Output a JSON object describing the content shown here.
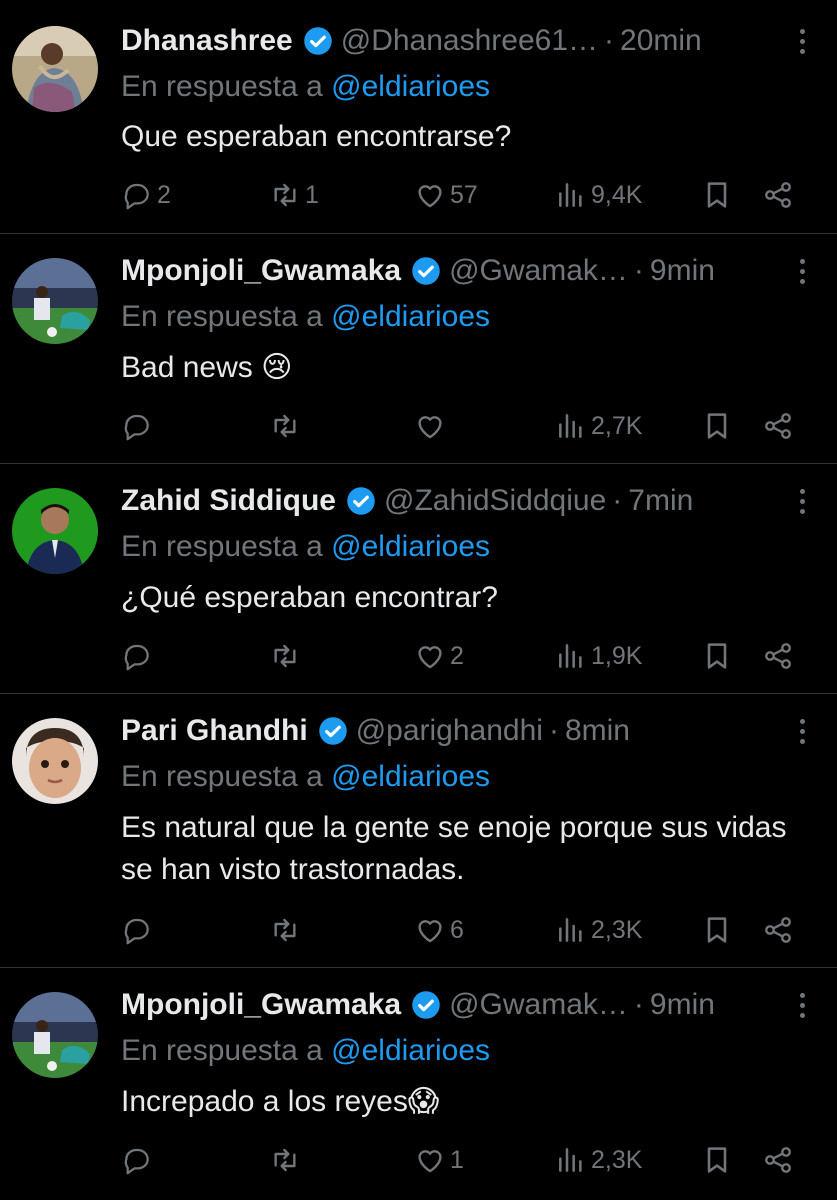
{
  "colors": {
    "background": "#000000",
    "text": "#e7e9ea",
    "muted": "#71767b",
    "link": "#1d9bf0",
    "verified": "#1d9bf0",
    "divider": "#2f3336"
  },
  "reply_prefix": "En respuesta a",
  "tweets": [
    {
      "name": "Dhanashree",
      "handle": "@Dhanashree61…",
      "time": "20min",
      "reply_to": "@eldiarioes",
      "text": "Que esperaban encontrarse?",
      "replies": "2",
      "retweets": "1",
      "likes": "57",
      "views": "9,4K",
      "avatar_icon": "user-avatar-dhanashree"
    },
    {
      "name": "Mponjoli_Gwamaka",
      "handle": "@Gwamak…",
      "time": "9min",
      "reply_to": "@eldiarioes",
      "text": "Bad news 😢",
      "replies": "",
      "retweets": "",
      "likes": "",
      "views": "2,7K",
      "avatar_icon": "user-avatar-football"
    },
    {
      "name": "Zahid Siddique",
      "handle": "@ZahidSiddqiue",
      "time": "7min",
      "reply_to": "@eldiarioes",
      "text": "¿Qué esperaban encontrar?",
      "replies": "",
      "retweets": "",
      "likes": "2",
      "views": "1,9K",
      "avatar_icon": "user-avatar-zahid"
    },
    {
      "name": "Pari Ghandhi",
      "handle": "@parighandhi",
      "time": "8min",
      "reply_to": "@eldiarioes",
      "text": "Es natural que la gente se enoje porque sus vidas se han visto trastornadas.",
      "replies": "",
      "retweets": "",
      "likes": "6",
      "views": "2,3K",
      "avatar_icon": "user-avatar-pari"
    },
    {
      "name": "Mponjoli_Gwamaka",
      "handle": "@Gwamak…",
      "time": "9min",
      "reply_to": "@eldiarioes",
      "text": "Increpado a los reyes😱",
      "replies": "",
      "retweets": "",
      "likes": "1",
      "views": "2,3K",
      "avatar_icon": "user-avatar-football"
    }
  ]
}
